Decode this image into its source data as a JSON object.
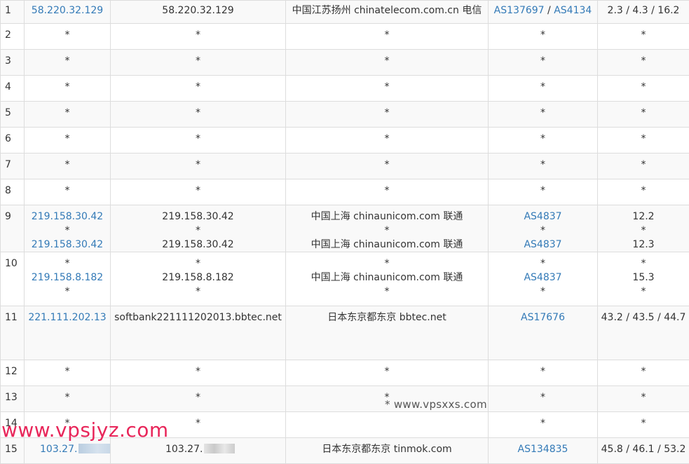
{
  "hops": [
    {
      "hop": "1",
      "rows": [
        {
          "ip": "58.220.32.129",
          "host": "58.220.32.129",
          "loc": "中国江苏扬州 chinatelecom.com.cn 电信",
          "as": [
            "AS137697",
            "AS4134"
          ],
          "time": "2.3 / 4.3 / 16.2"
        }
      ]
    },
    {
      "hop": "2",
      "rows": [
        {
          "ip": "*",
          "host": "*",
          "loc": "*",
          "as": [
            "*"
          ],
          "time": "*"
        }
      ]
    },
    {
      "hop": "3",
      "rows": [
        {
          "ip": "*",
          "host": "*",
          "loc": "*",
          "as": [
            "*"
          ],
          "time": "*"
        }
      ]
    },
    {
      "hop": "4",
      "rows": [
        {
          "ip": "*",
          "host": "*",
          "loc": "*",
          "as": [
            "*"
          ],
          "time": "*"
        }
      ]
    },
    {
      "hop": "5",
      "rows": [
        {
          "ip": "*",
          "host": "*",
          "loc": "*",
          "as": [
            "*"
          ],
          "time": "*"
        }
      ]
    },
    {
      "hop": "6",
      "rows": [
        {
          "ip": "*",
          "host": "*",
          "loc": "*",
          "as": [
            "*"
          ],
          "time": "*"
        }
      ]
    },
    {
      "hop": "7",
      "rows": [
        {
          "ip": "*",
          "host": "*",
          "loc": "*",
          "as": [
            "*"
          ],
          "time": "*"
        }
      ]
    },
    {
      "hop": "8",
      "rows": [
        {
          "ip": "*",
          "host": "*",
          "loc": "*",
          "as": [
            "*"
          ],
          "time": "*"
        }
      ]
    },
    {
      "hop": "9",
      "rows": [
        {
          "ip": "219.158.30.42",
          "host": "219.158.30.42",
          "loc": "中国上海 chinaunicom.com 联通",
          "as": [
            "AS4837"
          ],
          "time": "12.2"
        },
        {
          "ip": "*",
          "host": "*",
          "loc": "*",
          "as": [
            "*"
          ],
          "time": "*"
        },
        {
          "ip": "219.158.30.42",
          "host": "219.158.30.42",
          "loc": "中国上海 chinaunicom.com 联通",
          "as": [
            "AS4837"
          ],
          "time": "12.3"
        }
      ]
    },
    {
      "hop": "10",
      "rows": [
        {
          "ip": "*",
          "host": "*",
          "loc": "*",
          "as": [
            "*"
          ],
          "time": "*"
        },
        {
          "ip": "219.158.8.182",
          "host": "219.158.8.182",
          "loc": "中国上海 chinaunicom.com 联通",
          "as": [
            "AS4837"
          ],
          "time": "15.3"
        },
        {
          "ip": "*",
          "host": "*",
          "loc": "*",
          "as": [
            "*"
          ],
          "time": "*"
        }
      ]
    },
    {
      "hop": "11",
      "rows": [
        {
          "ip": "221.111.202.13",
          "host": "softbank221111202013.bbtec.net",
          "loc": "日本东京都东京 bbtec.net",
          "as": [
            "AS17676"
          ],
          "time": "43.2 / 43.5 / 44.7"
        }
      ]
    },
    {
      "hop": "12",
      "rows": [
        {
          "ip": "*",
          "host": "*",
          "loc": "*",
          "as": [
            "*"
          ],
          "time": "*"
        }
      ]
    },
    {
      "hop": "13",
      "rows": [
        {
          "ip": "*",
          "host": "*",
          "loc": "*",
          "as": [
            "*"
          ],
          "time": "*"
        }
      ]
    },
    {
      "hop": "14",
      "rows": [
        {
          "ip": "*",
          "host": "*",
          "loc": "",
          "as": [
            "*"
          ],
          "time": "*"
        }
      ]
    },
    {
      "hop": "15",
      "rows": [
        {
          "ip": "103.27.",
          "host": "103.27.",
          "loc": "日本东京都东京 tinmok.com",
          "as": [
            "AS134835"
          ],
          "time": "45.8 / 46.1 / 53.2"
        }
      ]
    }
  ],
  "watermarks": {
    "center": "* www.vpsxxs.com",
    "bottom_left": "www.vpsjyz.com"
  },
  "colors": {
    "link": "#337ab7",
    "stripe": "#f9f9f9",
    "border": "#dddddd",
    "watermark_red": "#e8265a"
  }
}
